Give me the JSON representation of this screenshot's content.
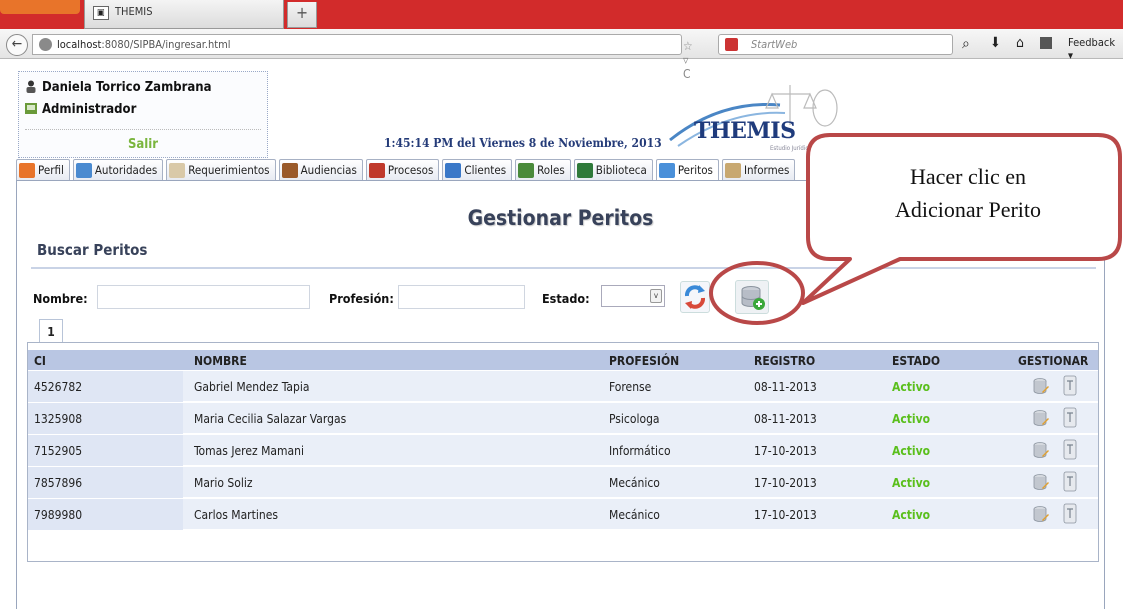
{
  "browser": {
    "tab_title": "THEMIS",
    "url_host": "localhost",
    "url_rest": ":8080/SIPBA/ingresar.html",
    "search_placeholder": "StartWeb",
    "feedback_label": "Feedback"
  },
  "user": {
    "name": "Daniela Torrico Zambrana",
    "role": "Administrador",
    "logout_label": "Salir"
  },
  "clock": "1:45:14 PM del Viernes 8 de Noviembre, 2013",
  "logo": {
    "text": "THEMIS",
    "subtitle": "Estudio Jurídico"
  },
  "tabs": [
    {
      "label": "Perfil",
      "color": "#e8742a"
    },
    {
      "label": "Autoridades",
      "color": "#4a8ad0"
    },
    {
      "label": "Requerimientos",
      "color": "#d9c9a8"
    },
    {
      "label": "Audiencias",
      "color": "#9a5a2a"
    },
    {
      "label": "Procesos",
      "color": "#c0392b"
    },
    {
      "label": "Clientes",
      "color": "#3a78c8"
    },
    {
      "label": "Roles",
      "color": "#4a8a3a"
    },
    {
      "label": "Biblioteca",
      "color": "#2f7a3a"
    },
    {
      "label": "Peritos",
      "color": "#4a90d9"
    },
    {
      "label": "Informes",
      "color": "#c8a870"
    }
  ],
  "active_tab": "Peritos",
  "page": {
    "title": "Gestionar Peritos",
    "section_title": "Buscar Peritos"
  },
  "filters": {
    "nombre_label": "Nombre:",
    "nombre_value": "",
    "profesion_label": "Profesión:",
    "profesion_value": "",
    "estado_label": "Estado:",
    "estado_value": ""
  },
  "pagination": {
    "current_page": "1"
  },
  "table": {
    "headers": [
      "CI",
      "NOMBRE",
      "PROFESIÓN",
      "REGISTRO",
      "ESTADO",
      "GESTIONAR"
    ],
    "rows": [
      {
        "ci": "4526782",
        "nombre": "Gabriel Mendez Tapia",
        "profesion": "Forense",
        "registro": "08-11-2013",
        "estado": "Activo"
      },
      {
        "ci": "1325908",
        "nombre": "Maria Cecilia Salazar Vargas",
        "profesion": "Psicologa",
        "registro": "08-11-2013",
        "estado": "Activo"
      },
      {
        "ci": "7152905",
        "nombre": "Tomas Jerez Mamani",
        "profesion": "Informático",
        "registro": "17-10-2013",
        "estado": "Activo"
      },
      {
        "ci": "7857896",
        "nombre": "Mario Soliz",
        "profesion": "Mecánico",
        "registro": "17-10-2013",
        "estado": "Activo"
      },
      {
        "ci": "7989980",
        "nombre": "Carlos Martines",
        "profesion": "Mecánico",
        "registro": "17-10-2013",
        "estado": "Activo"
      }
    ]
  },
  "annotation": {
    "line1": "Hacer clic en",
    "line2": "Adicionar Perito",
    "color": "#b94848"
  }
}
